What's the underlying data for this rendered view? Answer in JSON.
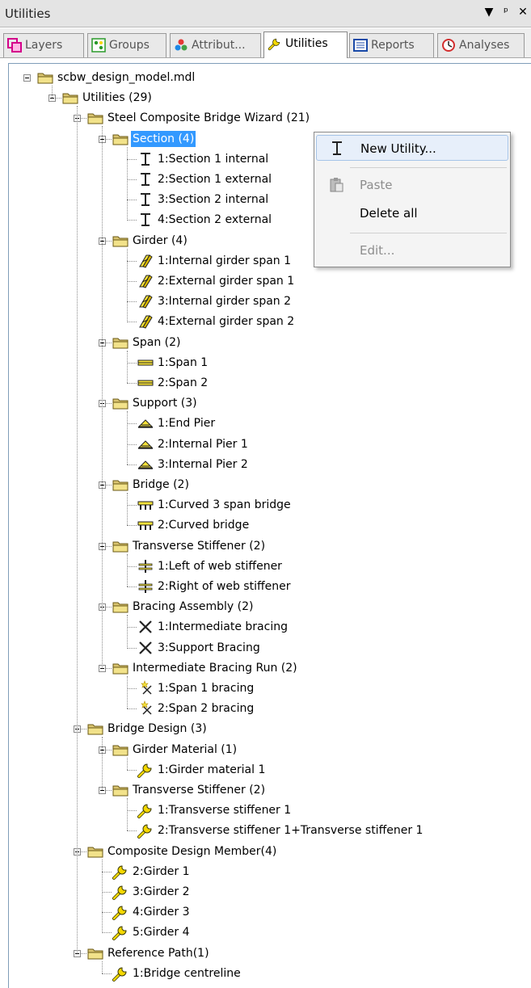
{
  "window": {
    "title": "Utilities"
  },
  "titlebar_buttons": [
    {
      "name": "dropdown-arrow-icon",
      "glyph": "▾"
    },
    {
      "name": "pin-icon",
      "glyph": "ᵖ"
    },
    {
      "name": "close-icon",
      "glyph": "✕"
    }
  ],
  "tabs": [
    {
      "label": "Layers",
      "icon": "layers-icon",
      "active": false
    },
    {
      "label": "Groups",
      "icon": "groups-icon",
      "active": false
    },
    {
      "label": "Attribut...",
      "icon": "attributes-icon",
      "active": false
    },
    {
      "label": "Utilities",
      "icon": "wrench-icon",
      "active": true
    },
    {
      "label": "Reports",
      "icon": "reports-icon",
      "active": false
    },
    {
      "label": "Analyses",
      "icon": "analyses-icon",
      "active": false
    }
  ],
  "tree": {
    "label": "scbw_design_model.mdl",
    "icon": "folder-icon",
    "children": [
      {
        "label": "Utilities (29)",
        "icon": "folder-icon",
        "children": [
          {
            "label": "Steel Composite Bridge Wizard (21)",
            "icon": "folder-icon",
            "children": [
              {
                "label": "Section (4)",
                "icon": "folder-icon",
                "selected": true,
                "children": [
                  {
                    "label": "1:Section 1 internal",
                    "icon": "section-icon"
                  },
                  {
                    "label": "2:Section 1 external",
                    "icon": "section-icon"
                  },
                  {
                    "label": "3:Section 2 internal",
                    "icon": "section-icon"
                  },
                  {
                    "label": "4:Section 2 external",
                    "icon": "section-icon"
                  }
                ]
              },
              {
                "label": "Girder (4)",
                "icon": "folder-icon",
                "children": [
                  {
                    "label": "1:Internal girder span 1",
                    "icon": "girder-icon"
                  },
                  {
                    "label": "2:External girder span 1",
                    "icon": "girder-icon"
                  },
                  {
                    "label": "3:Internal girder span 2",
                    "icon": "girder-icon"
                  },
                  {
                    "label": "4:External girder span 2",
                    "icon": "girder-icon"
                  }
                ]
              },
              {
                "label": "Span (2)",
                "icon": "folder-icon",
                "children": [
                  {
                    "label": "1:Span 1",
                    "icon": "span-icon"
                  },
                  {
                    "label": "2:Span 2",
                    "icon": "span-icon"
                  }
                ]
              },
              {
                "label": "Support (3)",
                "icon": "folder-icon",
                "children": [
                  {
                    "label": "1:End Pier",
                    "icon": "support-icon"
                  },
                  {
                    "label": "2:Internal Pier 1",
                    "icon": "support-icon"
                  },
                  {
                    "label": "3:Internal Pier 2",
                    "icon": "support-icon"
                  }
                ]
              },
              {
                "label": "Bridge (2)",
                "icon": "folder-icon",
                "children": [
                  {
                    "label": "1:Curved 3 span bridge",
                    "icon": "bridge-icon"
                  },
                  {
                    "label": "2:Curved bridge",
                    "icon": "bridge-icon"
                  }
                ]
              },
              {
                "label": "Transverse Stiffener (2)",
                "icon": "folder-icon",
                "children": [
                  {
                    "label": "1:Left of web stiffener",
                    "icon": "stiffener-icon"
                  },
                  {
                    "label": "2:Right of web stiffener",
                    "icon": "stiffener-icon"
                  }
                ]
              },
              {
                "label": "Bracing Assembly (2)",
                "icon": "folder-icon",
                "children": [
                  {
                    "label": "1:Intermediate bracing",
                    "icon": "bracing-icon"
                  },
                  {
                    "label": "3:Support Bracing",
                    "icon": "bracing-icon"
                  }
                ]
              },
              {
                "label": "Intermediate Bracing Run (2)",
                "icon": "folder-icon",
                "children": [
                  {
                    "label": "1:Span 1 bracing",
                    "icon": "bracing-run-icon"
                  },
                  {
                    "label": "2:Span 2 bracing",
                    "icon": "bracing-run-icon"
                  }
                ]
              }
            ]
          },
          {
            "label": "Bridge Design (3)",
            "icon": "folder-icon",
            "children": [
              {
                "label": "Girder Material (1)",
                "icon": "folder-icon",
                "children": [
                  {
                    "label": "1:Girder material 1",
                    "icon": "wrench-icon"
                  }
                ]
              },
              {
                "label": "Transverse Stiffener (2)",
                "icon": "folder-icon",
                "children": [
                  {
                    "label": "1:Transverse stiffener 1",
                    "icon": "wrench-icon"
                  },
                  {
                    "label": "2:Transverse stiffener 1+Transverse stiffener 1",
                    "icon": "wrench-icon"
                  }
                ]
              }
            ]
          },
          {
            "label": "Composite Design Member(4)",
            "icon": "folder-icon",
            "children": [
              {
                "label": "2:Girder 1",
                "icon": "wrench-icon"
              },
              {
                "label": "3:Girder 2",
                "icon": "wrench-icon"
              },
              {
                "label": "4:Girder 3",
                "icon": "wrench-icon"
              },
              {
                "label": "5:Girder 4",
                "icon": "wrench-icon"
              }
            ]
          },
          {
            "label": "Reference Path(1)",
            "icon": "folder-icon",
            "children": [
              {
                "label": "1:Bridge centreline",
                "icon": "wrench-icon"
              }
            ]
          }
        ]
      }
    ]
  },
  "context_menu": {
    "items": [
      {
        "label": "New Utility...",
        "icon": "new-utility-icon",
        "disabled": false,
        "hover": true
      },
      {
        "separator": true
      },
      {
        "label": "Paste",
        "icon": "paste-icon",
        "disabled": true
      },
      {
        "label": "Delete all",
        "disabled": false
      },
      {
        "separator": true
      },
      {
        "label": "Edit...",
        "disabled": true
      }
    ]
  }
}
